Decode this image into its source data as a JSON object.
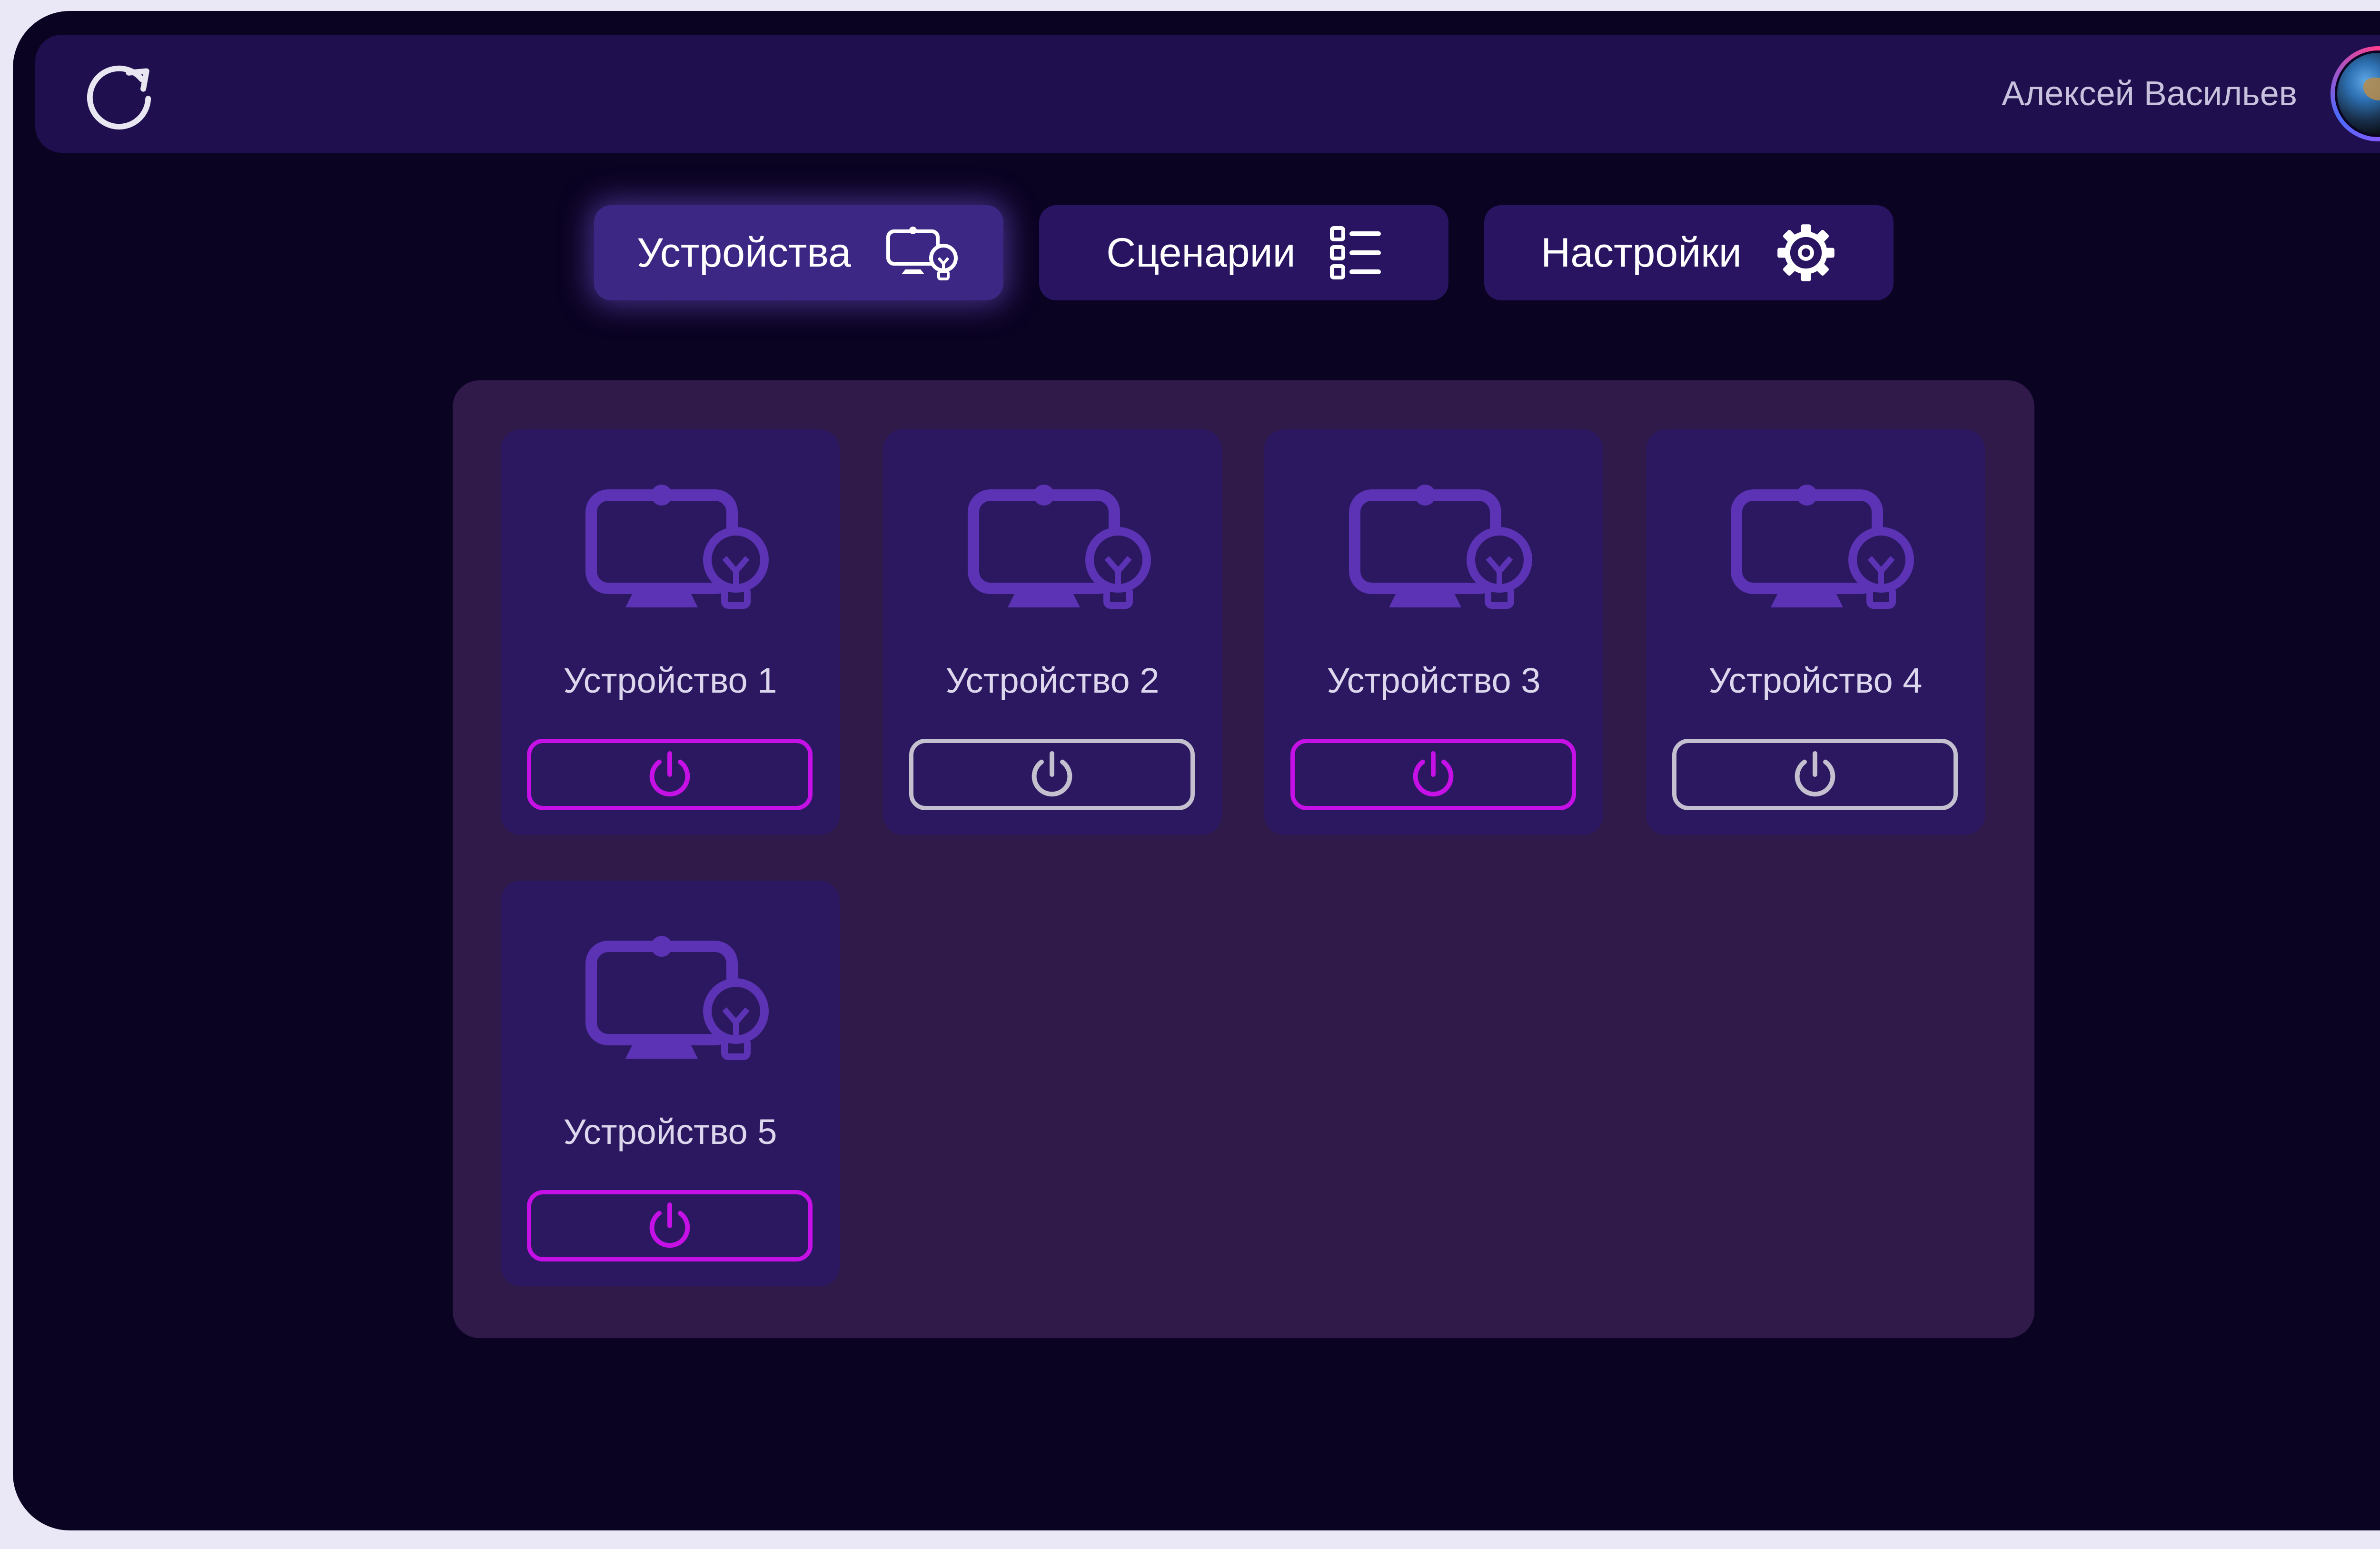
{
  "header": {
    "refresh_icon": "refresh-icon",
    "user_name": "Алексей Васильев",
    "avatar_icon": "earth-avatar"
  },
  "tabs": [
    {
      "label": "Устройства",
      "icon": "device-bulb-icon",
      "active": true
    },
    {
      "label": "Сценарии",
      "icon": "checklist-icon",
      "active": false
    },
    {
      "label": "Настройки",
      "icon": "gear-icon",
      "active": false
    }
  ],
  "devices": [
    {
      "name": "Устройство 1",
      "power": "on"
    },
    {
      "name": "Устройство 2",
      "power": "off"
    },
    {
      "name": "Устройство 3",
      "power": "on"
    },
    {
      "name": "Устройство 4",
      "power": "off"
    },
    {
      "name": "Устройство 5",
      "power": "on"
    }
  ],
  "colors": {
    "background": "#0b0322",
    "topbar": "#1f0f4e",
    "tab": "#291462",
    "tab_active": "#3c2884",
    "panel": "#2f1a4a",
    "card": "#2c1860",
    "device_icon": "#5b33b4",
    "power_on": "#c510e6",
    "power_off": "#c4c0cf"
  }
}
